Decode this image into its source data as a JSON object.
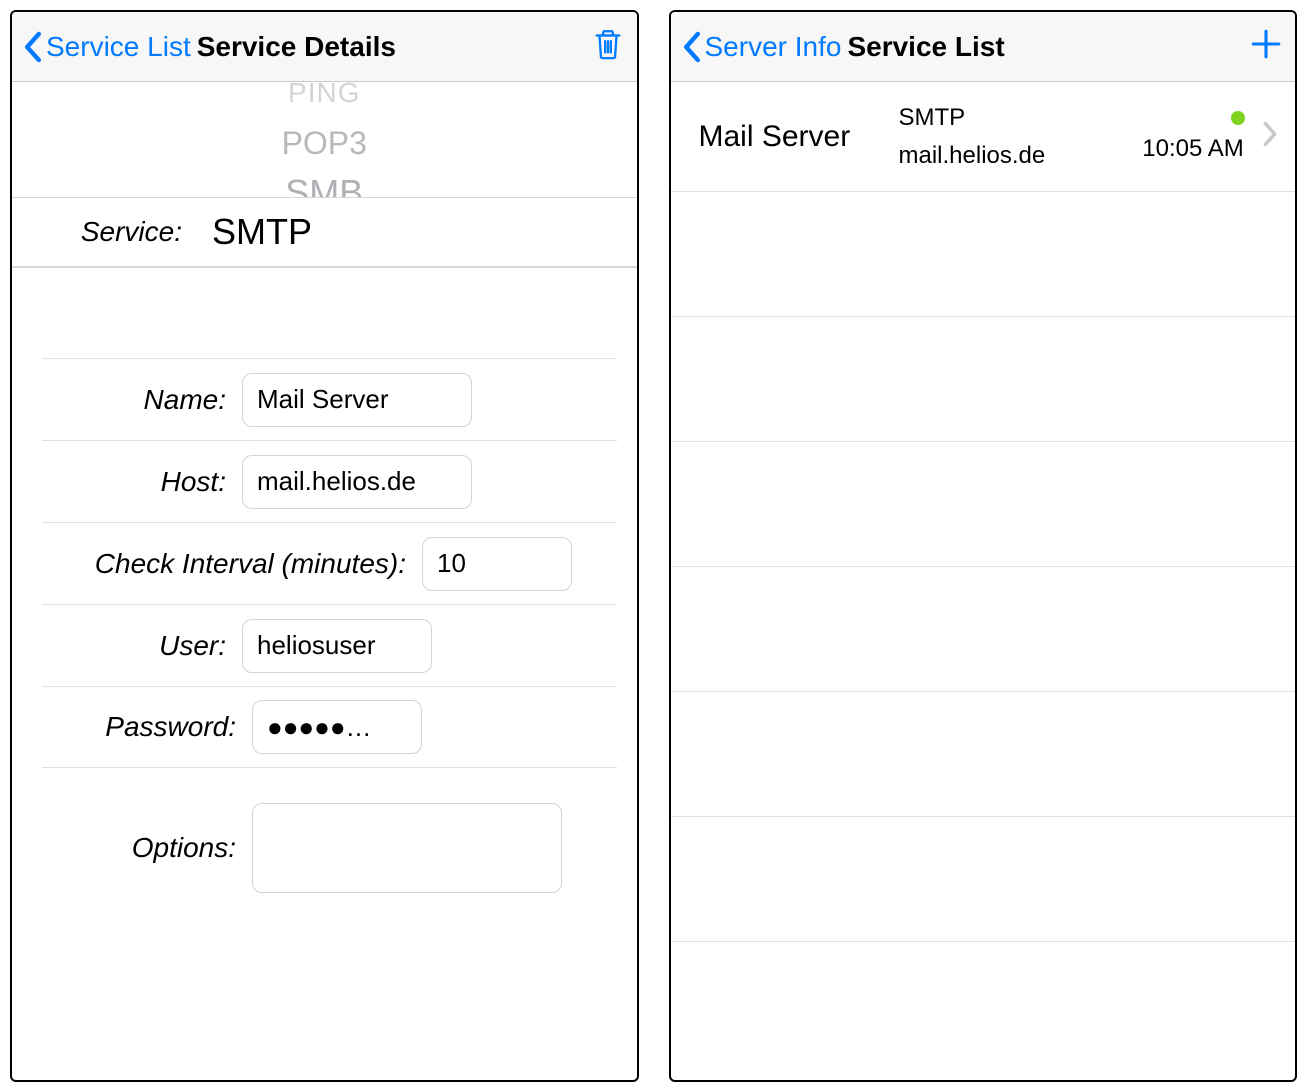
{
  "left": {
    "nav": {
      "back_label": "Service List",
      "title": "Service Details"
    },
    "picker": {
      "faint": "PING",
      "option2": "POP3",
      "option3": "SMB"
    },
    "service_label": "Service:",
    "service_value": "SMTP",
    "form": {
      "name_label": "Name:",
      "name_value": "Mail Server",
      "host_label": "Host:",
      "host_value": "mail.helios.de",
      "interval_label": "Check Interval (minutes):",
      "interval_value": "10",
      "user_label": "User:",
      "user_value": "heliosuser",
      "password_label": "Password:",
      "password_value": "●●●●●…",
      "options_label": "Options:",
      "options_value": ""
    }
  },
  "right": {
    "nav": {
      "back_label": "Server Info",
      "title": "Service List"
    },
    "rows": [
      {
        "name": "Mail Server",
        "service": "SMTP",
        "host": "mail.helios.de",
        "time": "10:05 AM"
      }
    ]
  }
}
